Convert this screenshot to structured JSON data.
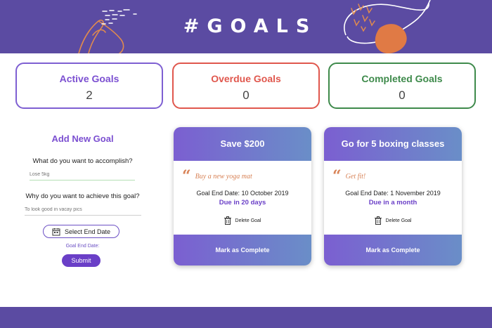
{
  "header": {
    "title": "#GOALS"
  },
  "stats": {
    "active": {
      "label": "Active Goals",
      "value": "2"
    },
    "overdue": {
      "label": "Overdue Goals",
      "value": "0"
    },
    "completed": {
      "label": "Completed Goals",
      "value": "0"
    }
  },
  "form": {
    "title": "Add New Goal",
    "q1": "What do you want to accomplish?",
    "q1_placeholder": "Lose 5kg",
    "q2": "Why do you want to achieve this goal?",
    "q2_placeholder": "To look good in vacay pics",
    "date_button": "Select End Date",
    "end_date_label": "Goal End Date:",
    "submit": "Submit"
  },
  "goals": [
    {
      "title": "Save $200",
      "reason": "Buy a new yoga mat",
      "end_date": "Goal End Date: 10 October 2019",
      "due": "Due in 20 days",
      "delete": "Delete Goal",
      "complete": "Mark as Complete"
    },
    {
      "title": "Go for 5 boxing classes",
      "reason": "Get fit!",
      "end_date": "Goal End Date: 1 November 2019",
      "due": "Due in a month",
      "delete": "Delete Goal",
      "complete": "Mark as Complete"
    }
  ],
  "colors": {
    "header_bg": "#5b4ba2",
    "accent_purple": "#7b4fd1",
    "overdue_red": "#e0574d",
    "completed_green": "#3e8a4b",
    "quote_orange": "#d88357"
  },
  "icons": [
    "hand-doodle-icon",
    "leaf-doodle-icon",
    "calendar-icon",
    "trash-icon",
    "quote-icon"
  ]
}
